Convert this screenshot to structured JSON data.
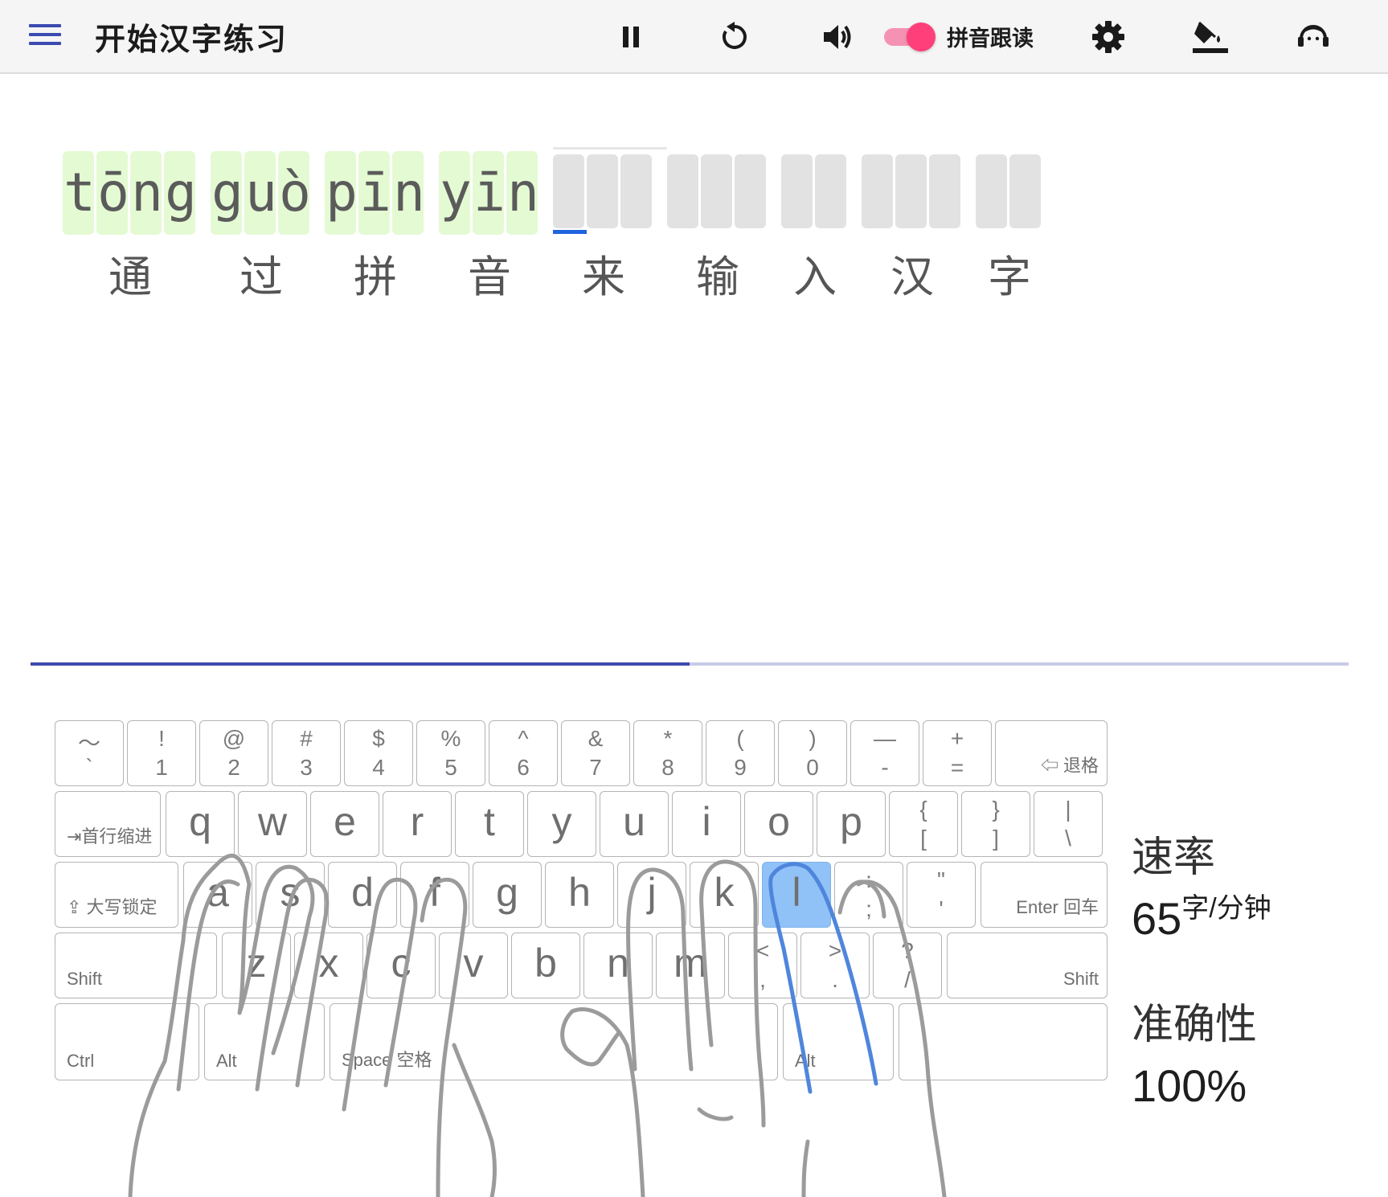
{
  "header": {
    "title": "开始汉字练习",
    "toggle_label": "拼音跟读",
    "toggle_on": true,
    "icons": [
      "menu-icon",
      "pause-icon",
      "restart-icon",
      "volume-icon",
      "settings-icon",
      "theme-fill-icon",
      "support-headset-icon"
    ]
  },
  "practice": {
    "words": [
      {
        "pinyin": "tōng",
        "hanzi": "通",
        "typed": true,
        "width": 4
      },
      {
        "pinyin": "guò",
        "hanzi": "过",
        "typed": true,
        "width": 3
      },
      {
        "pinyin": "pīn",
        "hanzi": "拼",
        "typed": true,
        "width": 3
      },
      {
        "pinyin": "yīn",
        "hanzi": "音",
        "typed": true,
        "width": 3
      },
      {
        "pinyin": "",
        "hanzi": "来",
        "typed": false,
        "width": 3
      },
      {
        "pinyin": "",
        "hanzi": "输",
        "typed": false,
        "width": 3
      },
      {
        "pinyin": "",
        "hanzi": "入",
        "typed": false,
        "width": 2
      },
      {
        "pinyin": "",
        "hanzi": "汉",
        "typed": false,
        "width": 3
      },
      {
        "pinyin": "",
        "hanzi": "字",
        "typed": false,
        "width": 2
      }
    ],
    "progress": 0.5
  },
  "keyboard": {
    "number_row": [
      {
        "top": "～",
        "bottom": "`"
      },
      {
        "top": "!",
        "bottom": "1"
      },
      {
        "top": "@",
        "bottom": "2"
      },
      {
        "top": "#",
        "bottom": "3"
      },
      {
        "top": "$",
        "bottom": "4"
      },
      {
        "top": "%",
        "bottom": "5"
      },
      {
        "top": "^",
        "bottom": "6"
      },
      {
        "top": "&",
        "bottom": "7"
      },
      {
        "top": "*",
        "bottom": "8"
      },
      {
        "top": "(",
        "bottom": "9"
      },
      {
        "top": ")",
        "bottom": "0"
      },
      {
        "top": "—",
        "bottom": "-"
      },
      {
        "top": "+",
        "bottom": "="
      }
    ],
    "backspace": "⇦ 退格",
    "tab": "⇥首行缩进",
    "caps": "⇪ 大写锁定",
    "enter": "Enter 回车",
    "shift": "Shift",
    "ctrl": "Ctrl",
    "alt": "Alt",
    "space": "Space 空格",
    "row_q": [
      "q",
      "w",
      "e",
      "r",
      "t",
      "y",
      "u",
      "i",
      "o",
      "p"
    ],
    "row_q_sym": [
      {
        "top": "{",
        "bottom": "["
      },
      {
        "top": "}",
        "bottom": "]"
      },
      {
        "top": "|",
        "bottom": "\\"
      }
    ],
    "row_a": [
      "a",
      "s",
      "d",
      "f",
      "g",
      "h",
      "j",
      "k",
      "l"
    ],
    "row_a_sym": [
      {
        "top": ":",
        "bottom": ";"
      },
      {
        "top": "\"",
        "bottom": "'"
      }
    ],
    "row_z": [
      "z",
      "x",
      "c",
      "v",
      "b",
      "n",
      "m"
    ],
    "row_z_sym": [
      {
        "top": "<",
        "bottom": ","
      },
      {
        "top": ">",
        "bottom": "."
      },
      {
        "top": "?",
        "bottom": "/"
      }
    ],
    "highlight_key": "l"
  },
  "stats": {
    "speed_label": "速率",
    "speed_value": "65",
    "speed_unit": "字/分钟",
    "accuracy_label": "准确性",
    "accuracy_value": "100%"
  },
  "colors": {
    "accent": "#3c4cab",
    "typed_bg": "#e4fad3",
    "empty_bg": "#e2e2e2",
    "cursor": "#1f63e0",
    "toggle": "#ff3f7a",
    "highlight_key": "#90c2f8",
    "active_finger": "#4f86dc"
  }
}
